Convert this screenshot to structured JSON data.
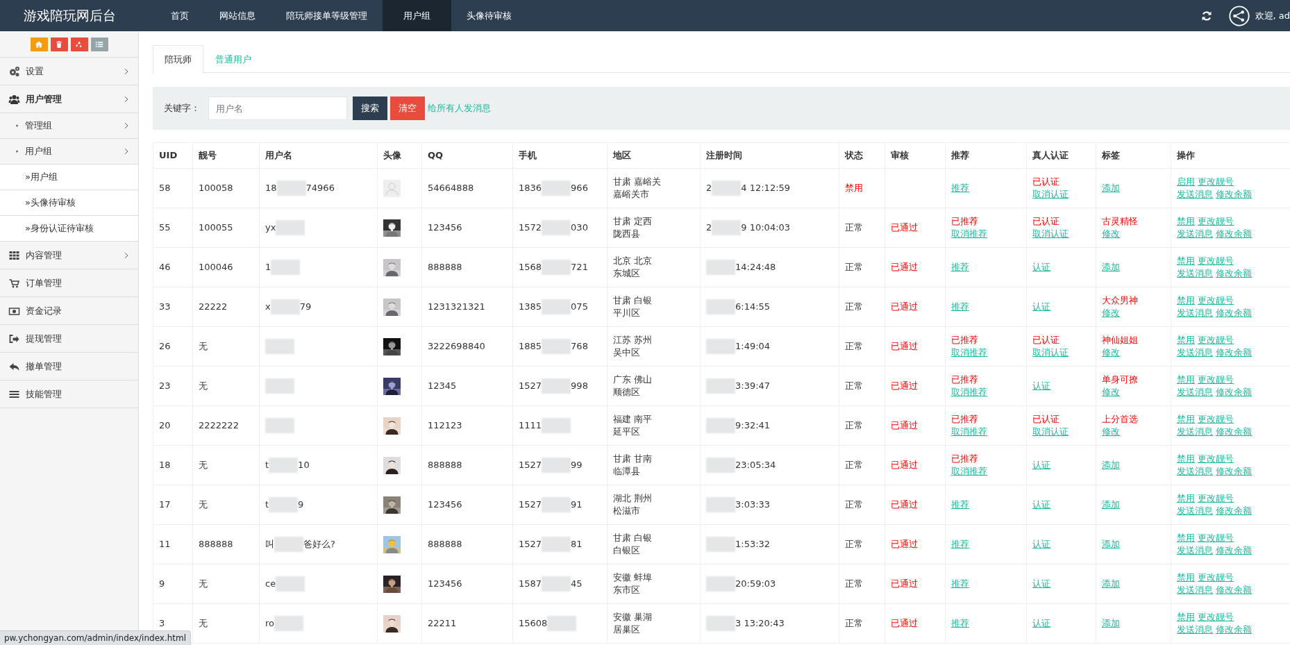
{
  "brand": "游戏陪玩网后台",
  "nav": [
    {
      "label": "首页",
      "selected": false
    },
    {
      "label": "网站信息",
      "selected": false
    },
    {
      "label": "陪玩师接单等级管理",
      "selected": false
    },
    {
      "label": "用户组",
      "selected": true
    },
    {
      "label": "头像待审核",
      "selected": false
    }
  ],
  "welcome": "欢迎, ad",
  "tool_buttons": [
    {
      "color": "#f39c12"
    },
    {
      "color": "#e74c3c"
    },
    {
      "color": "#e74c3c"
    },
    {
      "color": "#95a5a6"
    }
  ],
  "sidebar": {
    "items": [
      {
        "label": "设置",
        "expanded": false
      },
      {
        "label": "用户管理",
        "expanded": true,
        "children": [
          {
            "label": "管理组",
            "expanded": false
          },
          {
            "label": "用户组",
            "expanded": true,
            "children": [
              {
                "label": "»用户组"
              },
              {
                "label": "»头像待审核"
              },
              {
                "label": "»身份认证待审核"
              }
            ]
          }
        ]
      },
      {
        "label": "内容管理",
        "expanded": false
      },
      {
        "label": "订单管理"
      },
      {
        "label": "资金记录"
      },
      {
        "label": "提现管理"
      },
      {
        "label": "撤单管理"
      },
      {
        "label": "技能管理"
      }
    ]
  },
  "tabs": [
    {
      "label": "陪玩师",
      "selected": true
    },
    {
      "label": "普通用户",
      "selected": false
    }
  ],
  "search": {
    "label": "关键字：",
    "placeholder": "用户名",
    "buttons": [
      {
        "label": "搜索",
        "kind": "dark"
      },
      {
        "label": "清空",
        "kind": "danger"
      }
    ],
    "link": "给所有人发消息"
  },
  "table": {
    "columns": [
      "UID",
      "靓号",
      "用户名",
      "头像",
      "QQ",
      "手机",
      "地区",
      "注册时间",
      "状态",
      "审核",
      "推荐",
      "真人认证",
      "标签",
      "操作"
    ],
    "rows": [
      {
        "uid": "58",
        "number": "100058",
        "username": {
          "start": "18",
          "end": "74966"
        },
        "avatar": {
          "kind": "default"
        },
        "qq": "54664888",
        "phone": {
          "start": "1836",
          "end": "966"
        },
        "region": [
          "甘肃 嘉峪关",
          "嘉峪关市"
        ],
        "registered": {
          "start": "2",
          "end": "4 12:12:59"
        },
        "status": {
          "text": "禁用",
          "kind": "banned"
        },
        "recommend": [
          {
            "text": "推荐",
            "kind": "link"
          }
        ],
        "verify": [
          {
            "text": "已认证",
            "kind": "label"
          },
          {
            "text": "取消认证",
            "kind": "link"
          }
        ],
        "tag": [
          {
            "text": "添加",
            "kind": "link"
          }
        ],
        "actions": [
          [
            "启用",
            "更改靓号"
          ],
          [
            "发送消息",
            "修改余额"
          ]
        ]
      },
      {
        "uid": "55",
        "number": "100055",
        "username": {
          "start": "yx"
        },
        "avatar": {
          "kind": "picture"
        },
        "qq": "123456",
        "phone": {
          "start": "1572",
          "end": "030"
        },
        "region": [
          "甘肃 定西",
          "陇西县"
        ],
        "registered": {
          "start": "2",
          "end": "9 10:04:03"
        },
        "status": {
          "text": "正常",
          "kind": "normal"
        },
        "audit": "已通过",
        "recommend": [
          {
            "text": "已推荐",
            "kind": "label"
          },
          {
            "text": "取消推荐",
            "kind": "link"
          }
        ],
        "verify": [
          {
            "text": "已认证",
            "kind": "label"
          },
          {
            "text": "取消认证",
            "kind": "link"
          }
        ],
        "tag": [
          {
            "text": "古灵精怪",
            "kind": "label"
          },
          {
            "text": "修改",
            "kind": "link"
          }
        ],
        "actions": [
          [
            "禁用",
            "更改靓号"
          ],
          [
            "发送消息",
            "修改余额"
          ]
        ]
      },
      {
        "uid": "46",
        "number": "100046",
        "username": {
          "start": "1"
        },
        "avatar": {
          "kind": "picture"
        },
        "qq": "888888",
        "phone": {
          "start": "1568",
          "end": "721"
        },
        "region": [
          "北京 北京",
          "东城区"
        ],
        "registered": {
          "end": "14:24:48"
        },
        "status": {
          "text": "正常",
          "kind": "normal"
        },
        "audit": "已通过",
        "recommend": [
          {
            "text": "推荐",
            "kind": "link"
          }
        ],
        "verify": [
          {
            "text": "认证",
            "kind": "link"
          }
        ],
        "tag": [
          {
            "text": "添加",
            "kind": "link"
          }
        ],
        "actions": [
          [
            "禁用",
            "更改靓号"
          ],
          [
            "发送消息",
            "修改余额"
          ]
        ]
      },
      {
        "uid": "33",
        "number": "22222",
        "username": {
          "start": "x",
          "end": "79"
        },
        "avatar": {
          "kind": "picture"
        },
        "qq": "1231321321",
        "phone": {
          "start": "1385",
          "end": "075"
        },
        "region": [
          "甘肃 白银",
          "平川区"
        ],
        "registered": {
          "end": "6:14:55"
        },
        "status": {
          "text": "正常",
          "kind": "normal"
        },
        "audit": "已通过",
        "recommend": [
          {
            "text": "推荐",
            "kind": "link"
          }
        ],
        "verify": [
          {
            "text": "认证",
            "kind": "link"
          }
        ],
        "tag": [
          {
            "text": "大众男神",
            "kind": "label"
          },
          {
            "text": "修改",
            "kind": "link"
          }
        ],
        "actions": [
          [
            "禁用",
            "更改靓号"
          ],
          [
            "发送消息",
            "修改余额"
          ]
        ]
      },
      {
        "uid": "26",
        "number": "无",
        "username": {},
        "avatar": {
          "kind": "picture"
        },
        "qq": "3222698840",
        "phone": {
          "start": "1885",
          "end": "768"
        },
        "region": [
          "江苏 苏州",
          "吴中区"
        ],
        "registered": {
          "end": "1:49:04"
        },
        "status": {
          "text": "正常",
          "kind": "normal"
        },
        "audit": "已通过",
        "recommend": [
          {
            "text": "已推荐",
            "kind": "label"
          },
          {
            "text": "取消推荐",
            "kind": "link"
          }
        ],
        "verify": [
          {
            "text": "已认证",
            "kind": "label"
          },
          {
            "text": "取消认证",
            "kind": "link"
          }
        ],
        "tag": [
          {
            "text": "神仙姐姐",
            "kind": "label"
          },
          {
            "text": "修改",
            "kind": "link"
          }
        ],
        "actions": [
          [
            "禁用",
            "更改靓号"
          ],
          [
            "发送消息",
            "修改余额"
          ]
        ]
      },
      {
        "uid": "23",
        "number": "无",
        "username": {},
        "avatar": {
          "kind": "picture"
        },
        "qq": "12345",
        "phone": {
          "start": "1527",
          "end": "998"
        },
        "region": [
          "广东 佛山",
          "顺德区"
        ],
        "registered": {
          "end": "3:39:47"
        },
        "status": {
          "text": "正常",
          "kind": "normal"
        },
        "audit": "已通过",
        "recommend": [
          {
            "text": "已推荐",
            "kind": "label"
          },
          {
            "text": "取消推荐",
            "kind": "link"
          }
        ],
        "verify": [
          {
            "text": "认证",
            "kind": "link"
          }
        ],
        "tag": [
          {
            "text": "单身可撩",
            "kind": "label"
          },
          {
            "text": "修改",
            "kind": "link"
          }
        ],
        "actions": [
          [
            "禁用",
            "更改靓号"
          ],
          [
            "发送消息",
            "修改余额"
          ]
        ]
      },
      {
        "uid": "20",
        "number": "2222222",
        "username": {},
        "avatar": {
          "kind": "picture"
        },
        "qq": "112123",
        "phone": {
          "start": "1111"
        },
        "region": [
          "福建 南平",
          "延平区"
        ],
        "registered": {
          "end": "9:32:41"
        },
        "status": {
          "text": "正常",
          "kind": "normal"
        },
        "audit": "已通过",
        "recommend": [
          {
            "text": "已推荐",
            "kind": "label"
          },
          {
            "text": "取消推荐",
            "kind": "link"
          }
        ],
        "verify": [
          {
            "text": "已认证",
            "kind": "label"
          },
          {
            "text": "取消认证",
            "kind": "link"
          }
        ],
        "tag": [
          {
            "text": "上分首选",
            "kind": "label"
          },
          {
            "text": "修改",
            "kind": "link"
          }
        ],
        "actions": [
          [
            "禁用",
            "更改靓号"
          ],
          [
            "发送消息",
            "修改余额"
          ]
        ]
      },
      {
        "uid": "18",
        "number": "无",
        "username": {
          "start": "t",
          "end": "10"
        },
        "avatar": {
          "kind": "picture"
        },
        "qq": "888888",
        "phone": {
          "start": "1527",
          "end": "99"
        },
        "region": [
          "甘肃 甘南",
          "临潭县"
        ],
        "registered": {
          "end": "23:05:34"
        },
        "status": {
          "text": "正常",
          "kind": "normal"
        },
        "audit": "已通过",
        "recommend": [
          {
            "text": "已推荐",
            "kind": "label"
          },
          {
            "text": "取消推荐",
            "kind": "link"
          }
        ],
        "verify": [
          {
            "text": "认证",
            "kind": "link"
          }
        ],
        "tag": [
          {
            "text": "添加",
            "kind": "link"
          }
        ],
        "actions": [
          [
            "禁用",
            "更改靓号"
          ],
          [
            "发送消息",
            "修改余额"
          ]
        ]
      },
      {
        "uid": "17",
        "number": "无",
        "username": {
          "start": "t",
          "end": "9"
        },
        "avatar": {
          "kind": "picture"
        },
        "qq": "123456",
        "phone": {
          "start": "1527",
          "end": "91"
        },
        "region": [
          "湖北 荆州",
          "松滋市"
        ],
        "registered": {
          "end": "3:03:33"
        },
        "status": {
          "text": "正常",
          "kind": "normal"
        },
        "audit": "已通过",
        "recommend": [
          {
            "text": "推荐",
            "kind": "link"
          }
        ],
        "verify": [
          {
            "text": "认证",
            "kind": "link"
          }
        ],
        "tag": [
          {
            "text": "添加",
            "kind": "link"
          }
        ],
        "actions": [
          [
            "禁用",
            "更改靓号"
          ],
          [
            "发送消息",
            "修改余额"
          ]
        ]
      },
      {
        "uid": "11",
        "number": "888888",
        "username": {
          "start": "叫",
          "end": "爸好么?"
        },
        "avatar": {
          "kind": "picture"
        },
        "qq": "888888",
        "phone": {
          "start": "1527",
          "end": "81"
        },
        "region": [
          "甘肃 白银",
          "白银区"
        ],
        "registered": {
          "end": "1:53:32"
        },
        "status": {
          "text": "正常",
          "kind": "normal"
        },
        "audit": "已通过",
        "recommend": [
          {
            "text": "推荐",
            "kind": "link"
          }
        ],
        "verify": [
          {
            "text": "认证",
            "kind": "link"
          }
        ],
        "tag": [
          {
            "text": "添加",
            "kind": "link"
          }
        ],
        "actions": [
          [
            "禁用",
            "更改靓号"
          ],
          [
            "发送消息",
            "修改余额"
          ]
        ]
      },
      {
        "uid": "9",
        "number": "无",
        "username": {
          "start": "ce"
        },
        "avatar": {
          "kind": "picture"
        },
        "qq": "123456",
        "phone": {
          "start": "1587",
          "end": "45"
        },
        "region": [
          "安徽 蚌埠",
          "东市区"
        ],
        "registered": {
          "end": "20:59:03"
        },
        "status": {
          "text": "正常",
          "kind": "normal"
        },
        "audit": "已通过",
        "recommend": [
          {
            "text": "推荐",
            "kind": "link"
          }
        ],
        "verify": [
          {
            "text": "认证",
            "kind": "link"
          }
        ],
        "tag": [
          {
            "text": "添加",
            "kind": "link"
          }
        ],
        "actions": [
          [
            "禁用",
            "更改靓号"
          ],
          [
            "发送消息",
            "修改余额"
          ]
        ]
      },
      {
        "uid": "3",
        "number": "无",
        "username": {
          "start": "ro"
        },
        "avatar": {
          "kind": "picture"
        },
        "qq": "22211",
        "phone": {
          "start": "15608"
        },
        "region": [
          "安徽 巢湖",
          "居巢区"
        ],
        "registered": {
          "end": "3 13:20:43"
        },
        "status": {
          "text": "正常",
          "kind": "normal"
        },
        "audit": "已通过",
        "recommend": [
          {
            "text": "推荐",
            "kind": "link"
          }
        ],
        "verify": [
          {
            "text": "认证",
            "kind": "link"
          }
        ],
        "tag": [
          {
            "text": "添加",
            "kind": "link"
          }
        ],
        "actions": [
          [
            "禁用",
            "更改靓号"
          ],
          [
            "发送消息",
            "修改余额"
          ]
        ]
      }
    ]
  },
  "status_tooltip": "pw.ychongyan.com/admin/index/index.html"
}
